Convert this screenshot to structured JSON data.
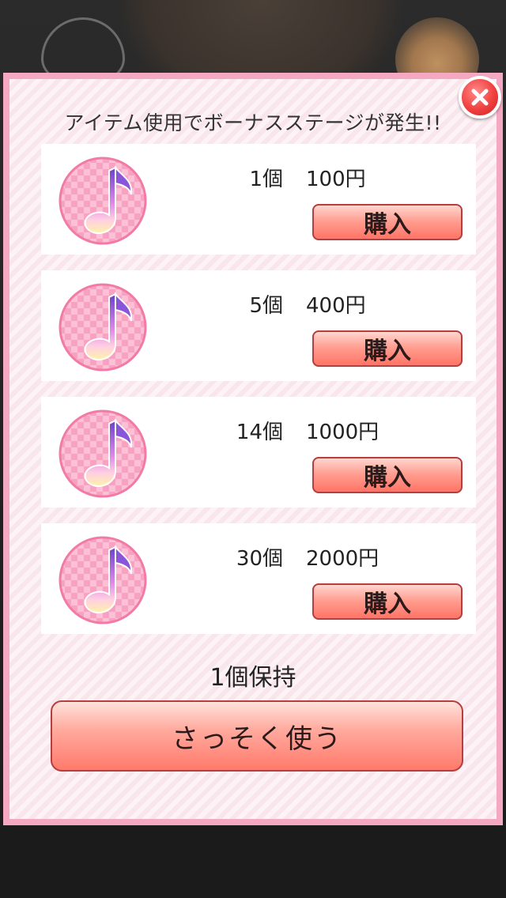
{
  "dialog": {
    "title": "アイテム使用でボーナスステージが発生!!",
    "items": [
      {
        "qty": "1個",
        "price": "100円",
        "buy_label": "購入"
      },
      {
        "qty": "5個",
        "price": "400円",
        "buy_label": "購入"
      },
      {
        "qty": "14個",
        "price": "1000円",
        "buy_label": "購入"
      },
      {
        "qty": "30個",
        "price": "2000円",
        "buy_label": "購入"
      }
    ],
    "held": "1個保持",
    "use_label": "さっそく使う",
    "close_icon": "close-icon",
    "item_icon": "music-note-icon"
  },
  "colors": {
    "frame": "#f5a8c1",
    "button": "#ff7465",
    "close": "#f0413f"
  }
}
